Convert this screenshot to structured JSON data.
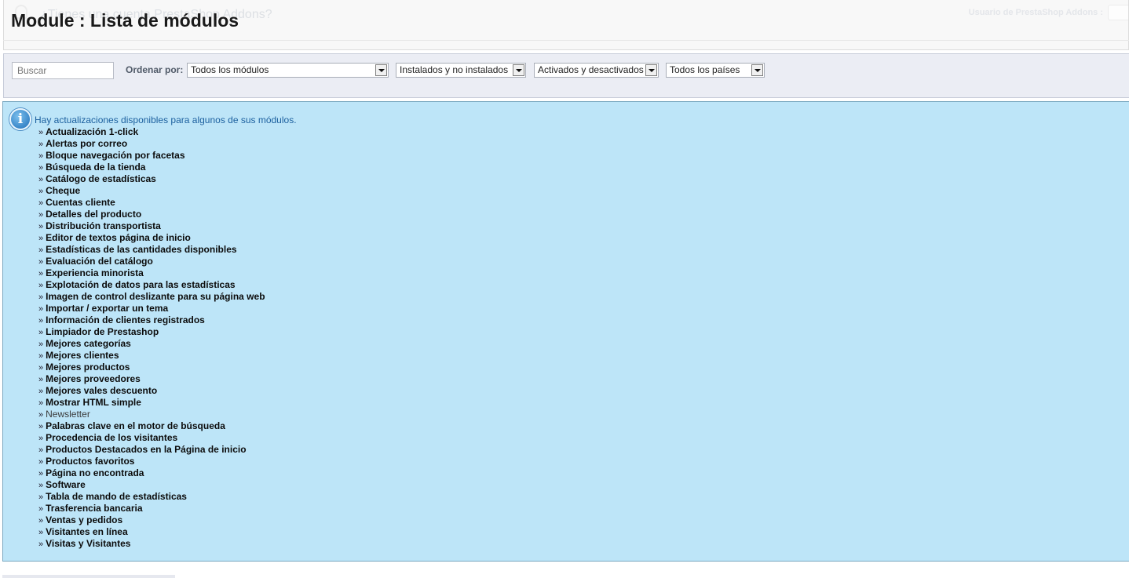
{
  "header": {
    "title": "Module : Lista de módulos",
    "ghost_question": "¿Tienes una cuenta PrestaShop Addons?",
    "ghost_user_label": "Usuario de PrestaShop Addons :"
  },
  "filters": {
    "search_placeholder": "Buscar",
    "order_label": "Ordenar por:",
    "selects": [
      {
        "value": "Todos los módulos"
      },
      {
        "value": "Instalados y no instalados"
      },
      {
        "value": "Activados y desactivados"
      },
      {
        "value": "Todos los países"
      }
    ]
  },
  "info": {
    "icon": "info-icon",
    "message": "Hay actualizaciones disponibles para algunos de sus módulos.",
    "modules": [
      "Actualización 1-click",
      "Alertas por correo",
      "Bloque navegación por facetas",
      "Búsqueda de la tienda",
      "Catálogo de estadísticas",
      "Cheque",
      "Cuentas cliente",
      "Detalles del producto",
      "Distribución transportista",
      "Editor de textos página de inicio",
      "Estadísticas de las cantidades disponibles",
      "Evaluación del catálogo",
      "Experiencia minorista",
      "Explotación de datos para las estadísticas",
      "Imagen de control deslizante para su página web",
      "Importar / exportar un tema",
      "Información de clientes registrados",
      "Limpiador de Prestashop",
      "Mejores categorías",
      "Mejores clientes",
      "Mejores productos",
      "Mejores proveedores",
      "Mejores vales descuento",
      "Mostrar HTML simple",
      "Newsletter",
      "Palabras clave en el motor de búsqueda",
      "Procedencia de los visitantes",
      "Productos Destacados en la Página de inicio",
      "Productos favoritos",
      "Página no encontrada",
      "Software",
      "Tabla de mando de estadísticas",
      "Trasferencia bancaria",
      "Ventas y pedidos",
      "Visitantes en línea",
      "Visitas y Visitantes"
    ],
    "bullet": "»"
  },
  "colors": {
    "info_bg": "#bde5f8",
    "info_text": "#1b5f9e",
    "filter_bg": "#ebedf4"
  }
}
